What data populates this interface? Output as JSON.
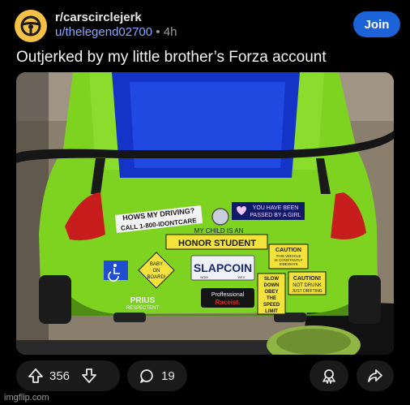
{
  "post": {
    "subreddit": "r/carscirclejerk",
    "author": "u/thelegend02700",
    "separator": "•",
    "age": "4h",
    "join_label": "Join",
    "title": "Outjerked by my little brother’s Forza account"
  },
  "image": {
    "stickers": {
      "how_line1": "HOWS MY DRIVING?",
      "how_line2": "CALL 1-800-IDONTCARE",
      "passed_line1": "YOU HAVE BEEN",
      "passed_line2": "PASSED BY A GIRL",
      "my_child": "MY CHILD IS AN",
      "honor_student": "HONOR STUDENT",
      "caution_title": "CAUTION",
      "caution_line1": "THIS VEHICLE",
      "caution_line2": "IS CONSTANTLY",
      "caution_line3": "SIDEWAYS",
      "baby_line1": "BABY",
      "baby_line2": "ON",
      "baby_line3": "BOARD!",
      "plate": "SLAPCOIN",
      "plate_left": "NOM",
      "plate_right": "WEX",
      "slow_line1": "SLOW",
      "slow_line2": "DOWN",
      "slow_line3": "OBEY",
      "slow_line4": "THE",
      "slow_line5": "SPEED",
      "slow_line6": "LIMIT",
      "caution2_line1": "CAUTION!",
      "caution2_line2": "NOT DRUNK",
      "caution2_line3": "JUST DRIFTING",
      "pro_line1": "Proffessional",
      "pro_line2": "Raceist.",
      "prius_line1": "PRIUS",
      "prius_line2": "RESPECTENT"
    }
  },
  "actions": {
    "score": "356",
    "comments": "19"
  },
  "watermark": "imgflip.com",
  "colors": {
    "accent": "#1b63d6",
    "car_green": "#7ed321",
    "subreddit_icon": "#f6c144"
  }
}
